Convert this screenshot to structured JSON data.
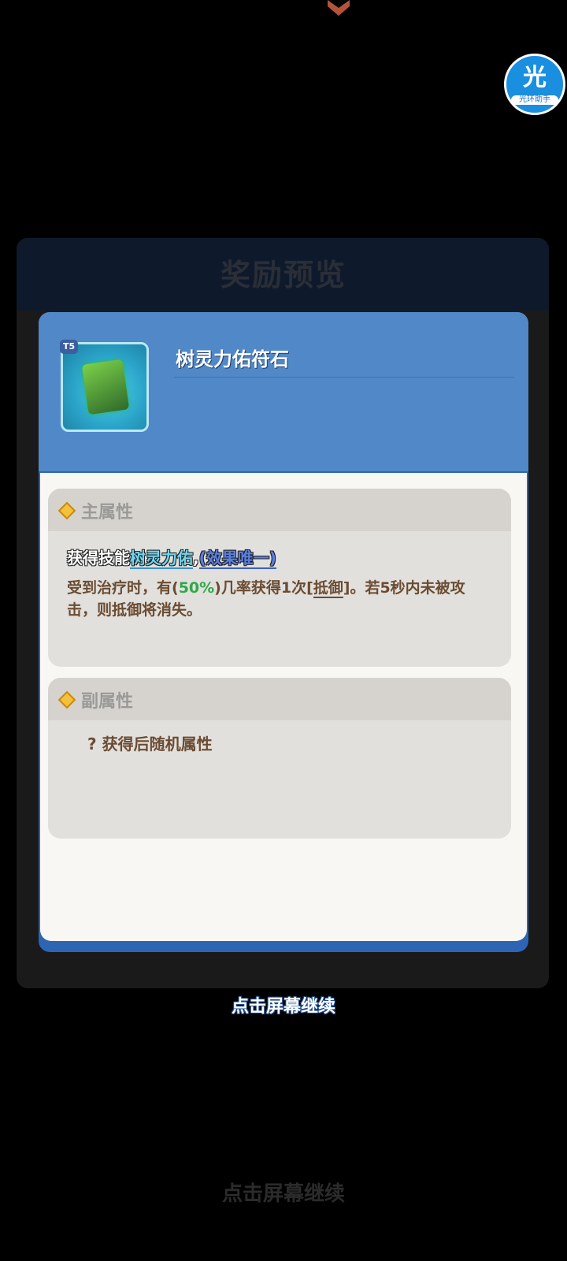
{
  "assistant_badge": {
    "glyph": "光",
    "label": "光环助手",
    "icon": "halo-assistant-icon"
  },
  "background_panel": {
    "title": "奖励预览"
  },
  "item": {
    "tier": "T5",
    "name": "树灵力佑符石",
    "icon": "rune-stone-icon"
  },
  "main_attributes": {
    "title": "主属性",
    "skill_prefix": "获得技能",
    "skill_name": "树灵力佑",
    "separator": ",",
    "effect_unique": "(效果唯一)",
    "desc_part1": "受到治疗时，有(",
    "desc_percent": "50%",
    "desc_part2": ")几率获得1次[",
    "desc_term": "抵御",
    "desc_part3": "]。若5秒内未被攻击，则抵御将消失。"
  },
  "sub_attributes": {
    "title": "副属性",
    "random_text": "? 获得后随机属性"
  },
  "tap_continue": "点击屏幕继续",
  "tap_continue_background": "点击屏幕继续",
  "colors": {
    "card_header": "#5088c8",
    "card_body": "#f8f7f3",
    "percent": "#2ea84a",
    "skill": "#6fd6f0"
  }
}
